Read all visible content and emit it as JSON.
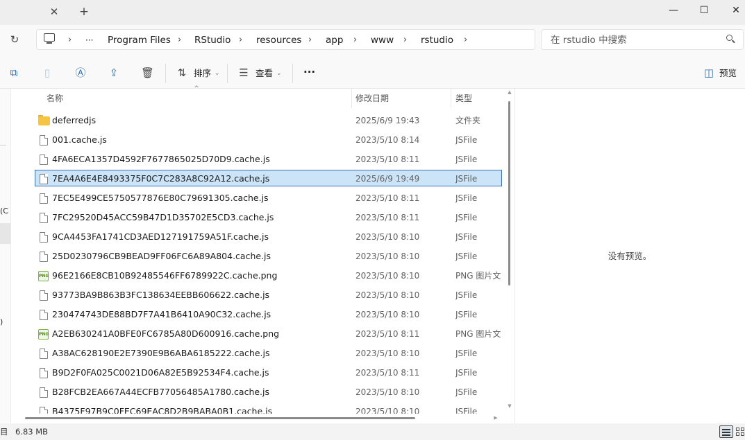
{
  "window": {
    "minimize_glyph": "—",
    "maximize_glyph": "☐",
    "close_glyph": "✕",
    "tab_close_glyph": "✕",
    "new_tab_glyph": "+"
  },
  "address": {
    "more_glyph": "···",
    "crumbs": [
      "Program Files",
      "RStudio",
      "resources",
      "app",
      "www",
      "rstudio"
    ],
    "chevron": "›"
  },
  "search": {
    "placeholder": "在 rstudio 中搜索"
  },
  "toolbar": {
    "sort_label": "排序",
    "view_label": "查看",
    "more_glyph": "···",
    "preview_label": "预览"
  },
  "columns": {
    "name": "名称",
    "date": "修改日期",
    "type": "类型"
  },
  "files": [
    {
      "name": "deferredjs",
      "date": "2025/6/9 19:43",
      "type": "文件夹",
      "icon": "folder-icon"
    },
    {
      "name": "001.cache.js",
      "date": "2023/5/10 8:14",
      "type": "JSFile",
      "icon": "file-icon"
    },
    {
      "name": "4FA6ECA1357D4592F7677865025D70D9.cache.js",
      "date": "2023/5/10 8:11",
      "type": "JSFile",
      "icon": "file-icon"
    },
    {
      "name": "7EA4A6E4E8493375F0C7C283A8C92A12.cache.js",
      "date": "2025/6/9 19:49",
      "type": "JSFile",
      "icon": "file-icon",
      "selected": true
    },
    {
      "name": "7EC5E499CE5750577876E80C79691305.cache.js",
      "date": "2023/5/10 8:11",
      "type": "JSFile",
      "icon": "file-icon"
    },
    {
      "name": "7FC29520D45ACC59B47D1D35702E5CD3.cache.js",
      "date": "2023/5/10 8:11",
      "type": "JSFile",
      "icon": "file-icon"
    },
    {
      "name": "9CA4453FA1741CD3AED127191759A51F.cache.js",
      "date": "2023/5/10 8:10",
      "type": "JSFile",
      "icon": "file-icon"
    },
    {
      "name": "25D0230796CB9BEAD9FF06FC6A89A804.cache.js",
      "date": "2023/5/10 8:10",
      "type": "JSFile",
      "icon": "file-icon"
    },
    {
      "name": "96E2166E8CB10B92485546FF6789922C.cache.png",
      "date": "2023/5/10 8:10",
      "type": "PNG 图片文",
      "icon": "png-icon"
    },
    {
      "name": "93773BA9B863B3FC138634EEBB606622.cache.js",
      "date": "2023/5/10 8:10",
      "type": "JSFile",
      "icon": "file-icon"
    },
    {
      "name": "230474743DE88BD7F7A41B6410A90C32.cache.js",
      "date": "2023/5/10 8:10",
      "type": "JSFile",
      "icon": "file-icon"
    },
    {
      "name": "A2EB630241A0BFE0FC6785A80D600916.cache.png",
      "date": "2023/5/10 8:11",
      "type": "PNG 图片文",
      "icon": "png-icon"
    },
    {
      "name": "A38AC628190E2E7390E9B6ABA6185222.cache.js",
      "date": "2023/5/10 8:10",
      "type": "JSFile",
      "icon": "file-icon"
    },
    {
      "name": "B9D2F0FA025C0021D06A82E5B92534F4.cache.js",
      "date": "2023/5/10 8:11",
      "type": "JSFile",
      "icon": "file-icon"
    },
    {
      "name": "B28FCB2EA667A44ECFB77056485A1780.cache.js",
      "date": "2023/5/10 8:10",
      "type": "JSFile",
      "icon": "file-icon"
    },
    {
      "name": "B4375F97B9C0FEC69EAC8D2B9BABA0B1.cache.js",
      "date": "2023/5/10 8:10",
      "type": "JSFile",
      "icon": "file-icon"
    }
  ],
  "preview": {
    "empty_text": "没有预览。"
  },
  "navpane": {
    "frag1": "(C",
    "frag2": ")"
  },
  "status": {
    "frag": "目",
    "size": "6.83 MB"
  },
  "png_badge": "PNG"
}
